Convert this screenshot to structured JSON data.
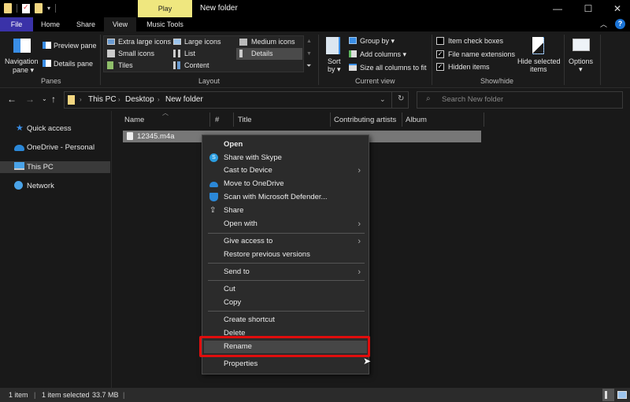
{
  "titlebar": {
    "contextual_tab": "Play",
    "window_title": "New folder",
    "minimize_icon": "minimize-icon",
    "maximize_icon": "maximize-icon",
    "close_icon": "close-icon"
  },
  "tabs": [
    {
      "label": "File"
    },
    {
      "label": "Home"
    },
    {
      "label": "Share"
    },
    {
      "label": "View"
    },
    {
      "label": "Music Tools"
    }
  ],
  "ribbon": {
    "panes": {
      "group_label": "Panes",
      "navigation_pane_line1": "Navigation",
      "navigation_pane_line2": "pane ▾",
      "preview_pane": "Preview pane",
      "details_pane": "Details pane"
    },
    "layout": {
      "group_label": "Layout",
      "options": [
        "Extra large icons",
        "Large icons",
        "Medium icons",
        "Small icons",
        "List",
        "Details",
        "Tiles",
        "Content"
      ],
      "selected": "Details"
    },
    "current_view": {
      "group_label": "Current view",
      "sort_by_line1": "Sort",
      "sort_by_line2": "by ▾",
      "group_by": "Group by ▾",
      "add_columns": "Add columns ▾",
      "size_all_columns": "Size all columns to fit"
    },
    "show_hide": {
      "group_label": "Show/hide",
      "item_check_boxes": {
        "label": "Item check boxes",
        "checked": false
      },
      "file_name_extensions": {
        "label": "File name extensions",
        "checked": true
      },
      "hidden_items": {
        "label": "Hidden items",
        "checked": true
      },
      "hide_selected_line1": "Hide selected",
      "hide_selected_line2": "items"
    },
    "options": {
      "label": "Options",
      "arrow": "▾"
    }
  },
  "address": {
    "crumbs": [
      "This PC",
      "Desktop",
      "New folder"
    ],
    "search_placeholder": "Search New folder"
  },
  "navpane": {
    "items": [
      {
        "label": "Quick access",
        "icon": "star-icon"
      },
      {
        "label": "OneDrive - Personal",
        "icon": "cloud-icon"
      },
      {
        "label": "This PC",
        "icon": "computer-icon",
        "selected": true
      },
      {
        "label": "Network",
        "icon": "network-icon"
      }
    ]
  },
  "filelist": {
    "columns": [
      "Name",
      "#",
      "Title",
      "Contributing artists",
      "Album"
    ],
    "files": [
      {
        "name": "12345.m4a",
        "selected": true
      }
    ]
  },
  "context_menu": {
    "items": [
      {
        "label": "Open",
        "bold": true
      },
      {
        "label": "Share with Skype",
        "icon": "skype-icon"
      },
      {
        "label": "Cast to Device",
        "submenu": true
      },
      {
        "label": "Move to OneDrive",
        "icon": "onedrive-icon"
      },
      {
        "label": "Scan with Microsoft Defender...",
        "icon": "defender-icon"
      },
      {
        "label": "Share",
        "icon": "share-icon"
      },
      {
        "label": "Open with",
        "submenu": true
      },
      {
        "label": "Give access to",
        "submenu": true
      },
      {
        "label": "Restore previous versions"
      },
      {
        "label": "Send to",
        "submenu": true
      },
      {
        "label": "Cut"
      },
      {
        "label": "Copy"
      },
      {
        "label": "Create shortcut"
      },
      {
        "label": "Delete"
      },
      {
        "label": "Rename",
        "highlighted": true
      },
      {
        "label": "Properties"
      }
    ],
    "submenu_arrow": "›",
    "highlight_color": "#e00d0d"
  },
  "statusbar": {
    "item_count": "1 item",
    "selection": "1 item selected",
    "size": "33.7 MB"
  }
}
